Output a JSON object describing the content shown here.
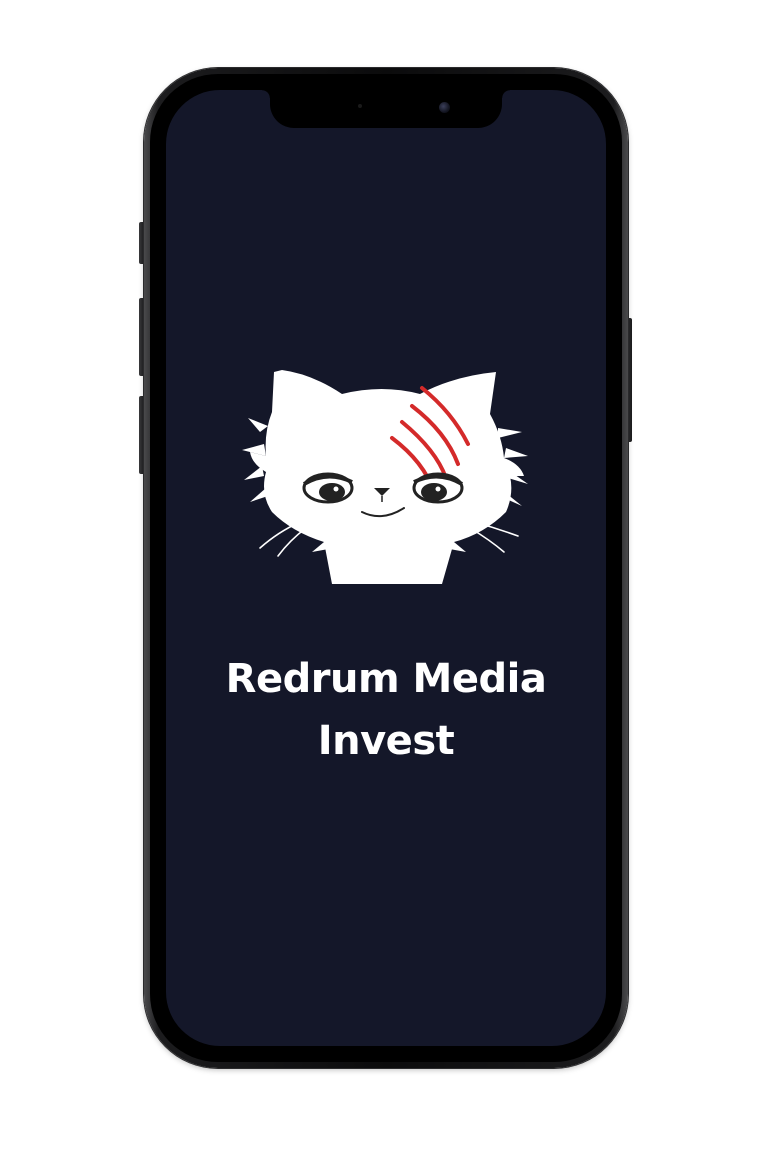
{
  "app": {
    "title_line1": "Redrum Media",
    "title_line2": "Invest"
  },
  "logo": {
    "icon": "cat-logo-icon",
    "scratch_color": "#d42a2a"
  },
  "colors": {
    "screen_background": "#141729",
    "title_text": "#ffffff",
    "device_frame": "#0b0b0c"
  }
}
